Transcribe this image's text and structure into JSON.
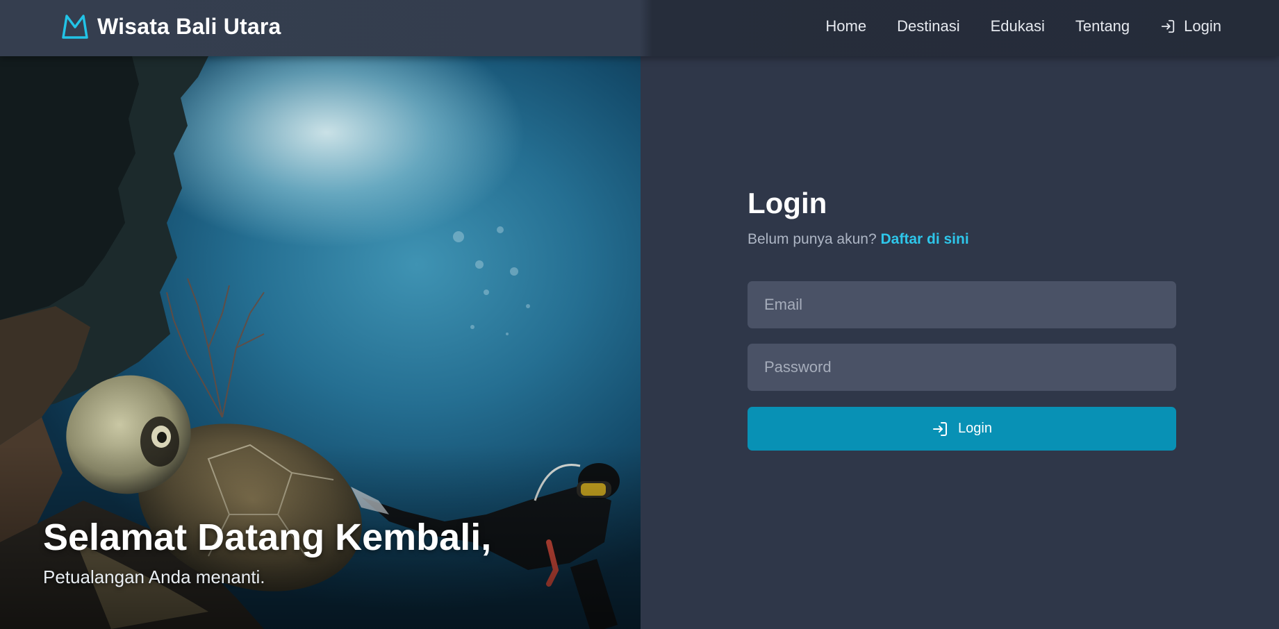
{
  "brand": {
    "name": "Wisata Bali Utara",
    "icon": "mountain-icon",
    "accent_color": "#22c3e6"
  },
  "nav": {
    "items": [
      {
        "label": "Home"
      },
      {
        "label": "Destinasi"
      },
      {
        "label": "Edukasi"
      },
      {
        "label": "Tentang"
      }
    ],
    "login_label": "Login",
    "login_icon": "login-arrow-icon"
  },
  "hero": {
    "title": "Selamat Datang Kembali,",
    "subtitle": "Petualangan Anda menanti.",
    "image": "underwater-turtle-diver-photo"
  },
  "login": {
    "heading": "Login",
    "prompt": "Belum punya akun?",
    "register_link": "Daftar di sini",
    "email": {
      "placeholder": "Email",
      "value": ""
    },
    "password": {
      "placeholder": "Password",
      "value": ""
    },
    "submit_label": "Login",
    "submit_icon": "login-arrow-icon",
    "button_color": "#0891b5"
  }
}
